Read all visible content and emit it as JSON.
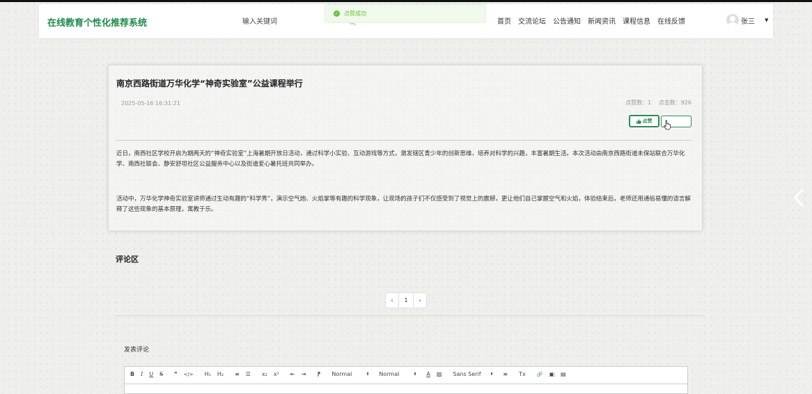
{
  "header": {
    "brand": "在线教育个性化推荐系统",
    "search_placeholder": "输入关键词",
    "nav": [
      "首页",
      "交流论坛",
      "公告通知",
      "新闻资讯",
      "课程信息",
      "在线反馈"
    ],
    "user_name": "张三"
  },
  "toast": {
    "message": "点赞成功",
    "type": "success"
  },
  "article": {
    "title": "南京西路街道万华化学“神奇实验室”公益课程举行",
    "time": "2025-05-16 16:31:21",
    "like_label": "点赞数：1",
    "click_label": "点击数：926",
    "like_button": "点赞",
    "paragraphs": [
      "近日，南西社区学校开启为期两天的“神奇实验室”上海暑期开放日活动，通过科学小实验、互动游戏等方式，激发辖区青少年的创新思维，培养对科学的兴趣，丰富暑期生活。本次活动由南京西路街道未保站联合万华化学、南西社联会、静安舒坦社区公益服务中心以及街道爱心暑托班共同举办。",
      "活动中，万华化学神奇实验室讲师通过生动有趣的“科学秀”，演示空气炮、火焰掌等有趣的科学现象，让现场的孩子们不仅感受到了视觉上的震撼，更让他们自己掌握空气和火焰，体验结束后，老师还用通俗易懂的语言解释了这些现象的基本原理，寓教于乐。"
    ]
  },
  "comments": {
    "title": "评论区",
    "pagination": {
      "prev": "‹",
      "current": "1",
      "next": "›"
    },
    "post_title": "发表评论"
  },
  "editor": {
    "bold": "B",
    "italic": "I",
    "underline": "U",
    "strike": "S",
    "quote": "❞",
    "code": "</>",
    "h1": "H₁",
    "h2": "H₂",
    "ol": "≡",
    "ul": "☰",
    "sub": "x₂",
    "sup": "x²",
    "outdent": "⇤",
    "indent": "⇥",
    "rtl": "⁋",
    "size_value": "Normal",
    "header_value": "Normal",
    "color": "A",
    "background": "▨",
    "font_value": "Sans Serif",
    "align": "≡",
    "clean": "Tx",
    "link": "🔗",
    "image": "▣",
    "video": "▤"
  },
  "colors": {
    "brand": "#1e8a4c",
    "success": "#67c23a",
    "accent": "#2e8b57"
  }
}
